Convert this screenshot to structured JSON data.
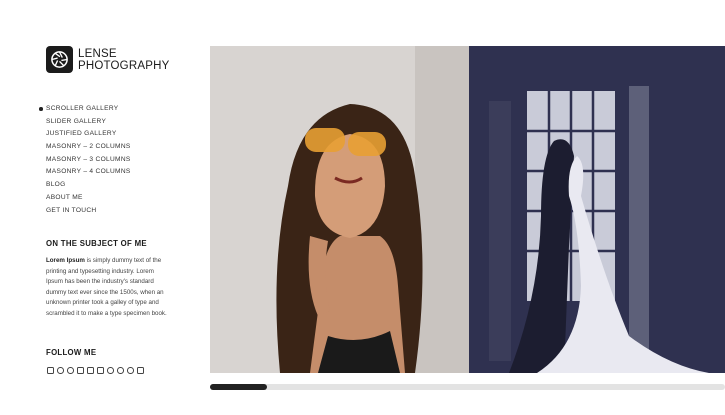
{
  "logo": {
    "line1": "LENSE",
    "line2": "PHOTOGRAPHY"
  },
  "menu": {
    "items": [
      {
        "label": "SCROLLER GALLERY",
        "active": true
      },
      {
        "label": "SLIDER GALLERY"
      },
      {
        "label": "JUSTIFIED GALLERY"
      },
      {
        "label": "MASONRY – 2 COLUMNS"
      },
      {
        "label": "MASONRY – 3 COLUMNS"
      },
      {
        "label": "MASONRY – 4 COLUMNS"
      },
      {
        "label": "BLOG"
      },
      {
        "label": "ABOUT ME"
      },
      {
        "label": "GET IN TOUCH"
      }
    ]
  },
  "about": {
    "title": "ON THE SUBJECT OF ME",
    "bold": "Lorem Ipsum",
    "text": " is simply dummy text of the printing and typesetting industry. Lorem Ipsum has been the industry's standard dummy text ever since the 1500s, when an unknown printer took a galley of type and scrambled it to make a type specimen book."
  },
  "follow": {
    "title": "FOLLOW ME",
    "icons": [
      "instagram-icon",
      "medium-icon",
      "pinterest-icon",
      "youtube-icon",
      "vimeo-icon",
      "tumblr-icon",
      "flickr-icon",
      "wordpress-icon",
      "foursquare-icon",
      "soundcloud-icon"
    ]
  },
  "gallery": {
    "photos": [
      "woman-sunglasses-photo",
      "wedding-couple-window-photo"
    ],
    "scroll_progress": 0.11
  },
  "colors": {
    "accent": "#222222",
    "duotone": "#2f3150",
    "track": "#e3e3e3"
  }
}
